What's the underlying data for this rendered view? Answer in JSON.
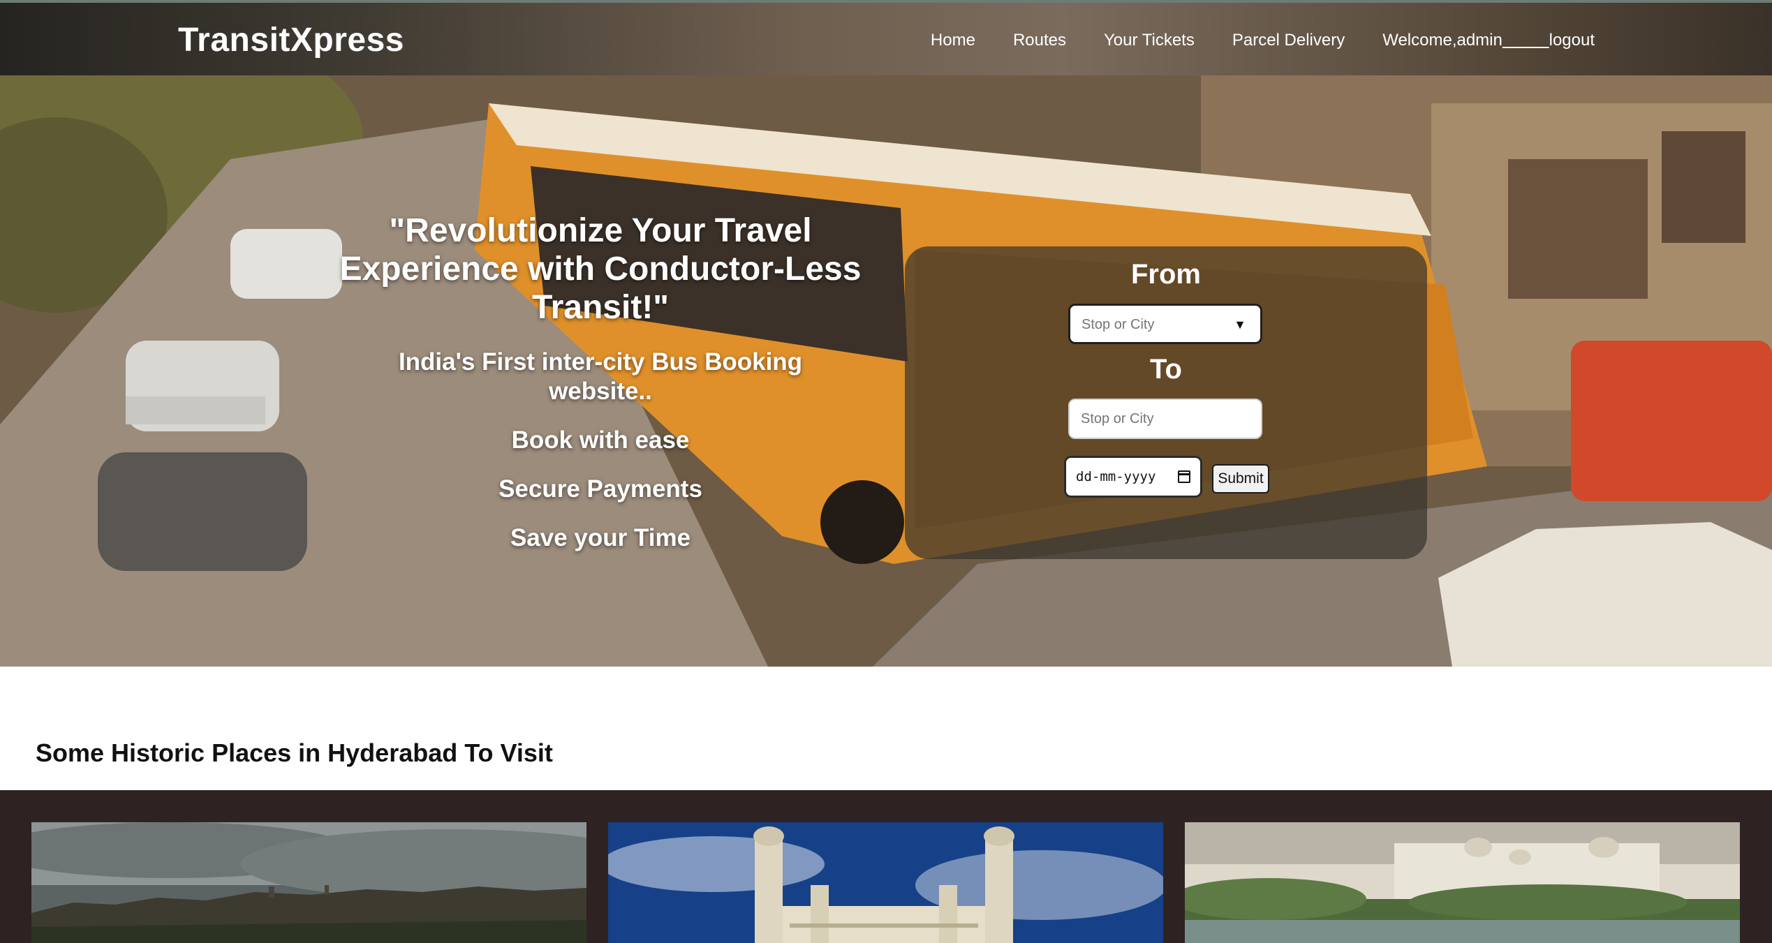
{
  "navbar": {
    "brand": "TransitXpress",
    "links": [
      "Home",
      "Routes",
      "Your Tickets",
      "Parcel Delivery"
    ],
    "welcome": "Welcome,admin",
    "logout": "logout"
  },
  "hero": {
    "title": "\"Revolutionize Your Travel Experience with Conductor-Less Transit!\"",
    "subtitle": "India's First inter-city Bus Booking website..",
    "points": [
      "Book with ease",
      "Secure Payments",
      "Save your Time"
    ]
  },
  "search": {
    "from_label": "From",
    "to_label": "To",
    "from_placeholder": "Stop or City",
    "to_placeholder": "Stop or City",
    "date_placeholder": "dd-mm-yyyy",
    "submit_label": "Submit"
  },
  "section": {
    "title": "Some Historic Places in Hyderabad To Visit",
    "places": [
      "fort-ruins-photo",
      "charminar-photo",
      "palace-lakeside-photo"
    ]
  }
}
